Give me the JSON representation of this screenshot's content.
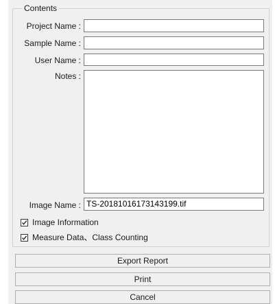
{
  "contents_group": {
    "title": "Contents",
    "project_name_label": "Project Name :",
    "project_name_value": "",
    "sample_name_label": "Sample Name :",
    "sample_name_value": "",
    "user_name_label": "User Name :",
    "user_name_value": "",
    "notes_label": "Notes :",
    "notes_value": "",
    "image_name_label": "Image Name :",
    "image_name_value": "TS-20181016173143199.tif"
  },
  "options": {
    "image_information": {
      "label": "Image Information",
      "checked": true
    },
    "measure_data": {
      "label": "Measure Data、Class Counting",
      "checked": true
    }
  },
  "buttons": {
    "export_report": "Export Report",
    "print": "Print",
    "cancel": "Cancel"
  }
}
